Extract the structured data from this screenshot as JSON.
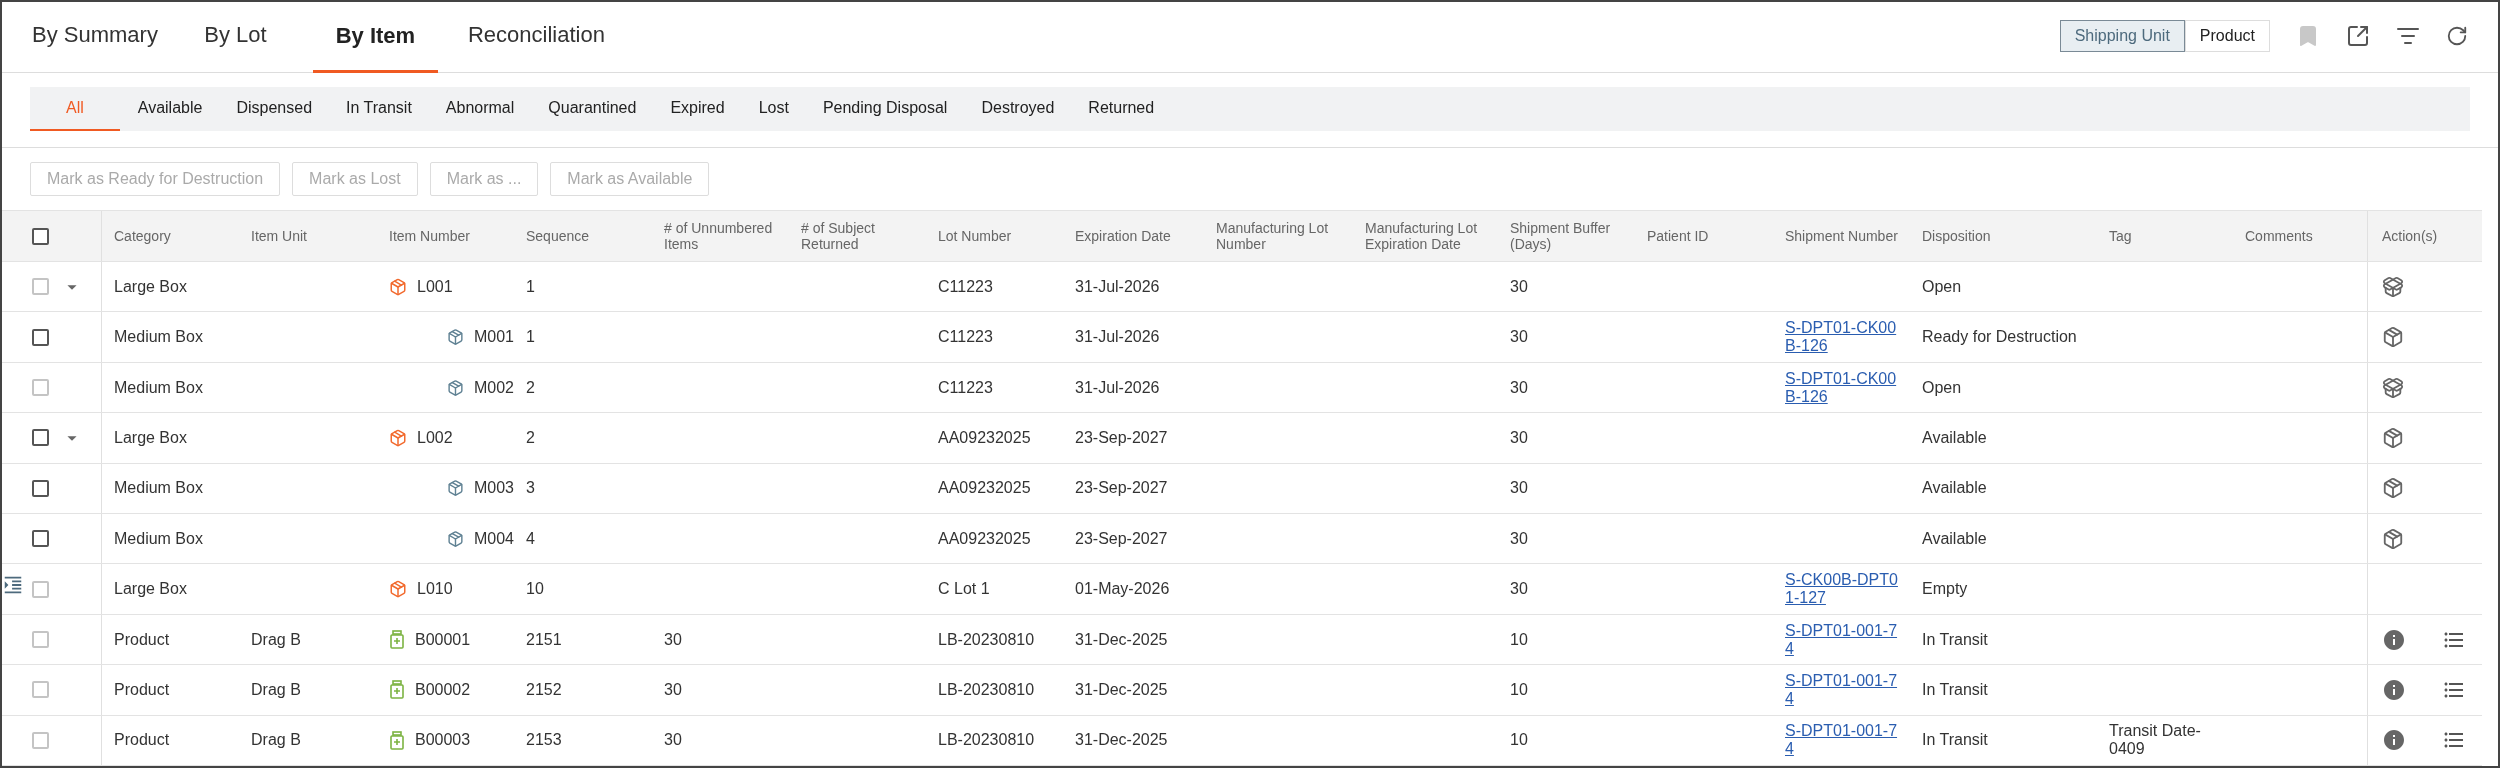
{
  "tabs": [
    {
      "label": "By Summary",
      "selected": false
    },
    {
      "label": "By Lot",
      "selected": false
    },
    {
      "label": "By Item",
      "selected": true
    },
    {
      "label": "Reconciliation",
      "selected": false
    }
  ],
  "view_toggle": [
    {
      "label": "Shipping Unit",
      "selected": true
    },
    {
      "label": "Product",
      "selected": false
    }
  ],
  "status_filters": [
    {
      "label": "All",
      "selected": true
    },
    {
      "label": "Available",
      "selected": false
    },
    {
      "label": "Dispensed",
      "selected": false
    },
    {
      "label": "In Transit",
      "selected": false
    },
    {
      "label": "Abnormal",
      "selected": false
    },
    {
      "label": "Quarantined",
      "selected": false
    },
    {
      "label": "Expired",
      "selected": false
    },
    {
      "label": "Lost",
      "selected": false
    },
    {
      "label": "Pending Disposal",
      "selected": false
    },
    {
      "label": "Destroyed",
      "selected": false
    },
    {
      "label": "Returned",
      "selected": false
    }
  ],
  "actions": [
    {
      "label": "Mark as Ready for Destruction",
      "disabled": true
    },
    {
      "label": "Mark as Lost",
      "disabled": true
    },
    {
      "label": "Mark as ...",
      "disabled": true
    },
    {
      "label": "Mark as Available",
      "disabled": true
    }
  ],
  "table": {
    "select_all": {
      "checked": false
    },
    "columns": [
      "Category",
      "Item Unit",
      "Item Number",
      "Sequence",
      "# of Unnumbered Items",
      "# of Subject Returned",
      "Lot Number",
      "Expiration Date",
      "Manufacturing Lot Number",
      "Manufacturing Lot Expiration Date",
      "Shipment Buffer (Days)",
      "Patient ID",
      "Shipment Number",
      "Disposition",
      "Tag",
      "Comments",
      "Action(s)"
    ],
    "rows": [
      {
        "checked": false,
        "checkbox_disabled": true,
        "expanded": true,
        "indent_marker": false,
        "category": "Large Box",
        "item": {
          "kind": "large",
          "number": "L001"
        },
        "sequence": "1",
        "lot": "C11223",
        "expiration": "31-Jul-2026",
        "buffer": "30",
        "disposition": "Open",
        "action": {
          "kind": "open-box"
        },
        "children": [
          {
            "checked": false,
            "checkbox_disabled": false,
            "indent_marker": false,
            "category": "Medium Box",
            "item": {
              "kind": "medium",
              "number": "M001"
            },
            "sequence": "1",
            "lot": "C11223",
            "expiration": "31-Jul-2026",
            "buffer": "30",
            "shipment": "S-DPT01-CK00B-126",
            "disposition": "Ready for Destruction",
            "action": {
              "kind": "closed-box"
            }
          },
          {
            "checked": false,
            "checkbox_disabled": true,
            "indent_marker": false,
            "category": "Medium Box",
            "item": {
              "kind": "medium",
              "number": "M002"
            },
            "sequence": "2",
            "lot": "C11223",
            "expiration": "31-Jul-2026",
            "buffer": "30",
            "shipment": "S-DPT01-CK00B-126",
            "disposition": "Open",
            "action": {
              "kind": "open-box"
            }
          }
        ]
      },
      {
        "checked": false,
        "checkbox_disabled": false,
        "expanded": true,
        "indent_marker": false,
        "category": "Large Box",
        "item": {
          "kind": "large",
          "number": "L002"
        },
        "sequence": "2",
        "lot": "AA09232025",
        "expiration": "23-Sep-2027",
        "buffer": "30",
        "disposition": "Available",
        "action": {
          "kind": "closed-box"
        },
        "children": [
          {
            "checked": false,
            "checkbox_disabled": false,
            "indent_marker": false,
            "category": "Medium Box",
            "item": {
              "kind": "medium",
              "number": "M003"
            },
            "sequence": "3",
            "lot": "AA09232025",
            "expiration": "23-Sep-2027",
            "buffer": "30",
            "disposition": "Available",
            "action": {
              "kind": "closed-box"
            }
          },
          {
            "checked": false,
            "checkbox_disabled": false,
            "indent_marker": false,
            "category": "Medium Box",
            "item": {
              "kind": "medium",
              "number": "M004"
            },
            "sequence": "4",
            "lot": "AA09232025",
            "expiration": "23-Sep-2027",
            "buffer": "30",
            "disposition": "Available",
            "action": {
              "kind": "closed-box"
            }
          }
        ]
      },
      {
        "checked": false,
        "checkbox_disabled": true,
        "indent_marker": true,
        "category": "Large Box",
        "item": {
          "kind": "large",
          "number": "L010"
        },
        "sequence": "10",
        "lot": "C Lot 1",
        "expiration": "01-May-2026",
        "buffer": "30",
        "shipment": "S-CK00B-DPT01-127",
        "disposition": "Empty"
      },
      {
        "checked": false,
        "checkbox_disabled": true,
        "indent_marker": false,
        "category": "Product",
        "item_unit": "Drag B",
        "item": {
          "kind": "product",
          "number": "B00001"
        },
        "sequence": "2151",
        "unnumbered": "30",
        "lot": "LB-20230810",
        "expiration": "31-Dec-2025",
        "buffer": "10",
        "shipment": "S-DPT01-001-74",
        "disposition": "In Transit",
        "action": {
          "kind": "info-list"
        }
      },
      {
        "checked": false,
        "checkbox_disabled": true,
        "indent_marker": false,
        "category": "Product",
        "item_unit": "Drag B",
        "item": {
          "kind": "product",
          "number": "B00002"
        },
        "sequence": "2152",
        "unnumbered": "30",
        "lot": "LB-20230810",
        "expiration": "31-Dec-2025",
        "buffer": "10",
        "shipment": "S-DPT01-001-74",
        "disposition": "In Transit",
        "action": {
          "kind": "info-list"
        }
      },
      {
        "checked": false,
        "checkbox_disabled": true,
        "indent_marker": false,
        "category": "Product",
        "item_unit": "Drag B",
        "item": {
          "kind": "product",
          "number": "B00003"
        },
        "sequence": "2153",
        "unnumbered": "30",
        "lot": "LB-20230810",
        "expiration": "31-Dec-2025",
        "buffer": "10",
        "shipment": "S-DPT01-001-74",
        "disposition": "In Transit",
        "tag": "Transit Date-0409",
        "action": {
          "kind": "info-list"
        }
      }
    ]
  }
}
